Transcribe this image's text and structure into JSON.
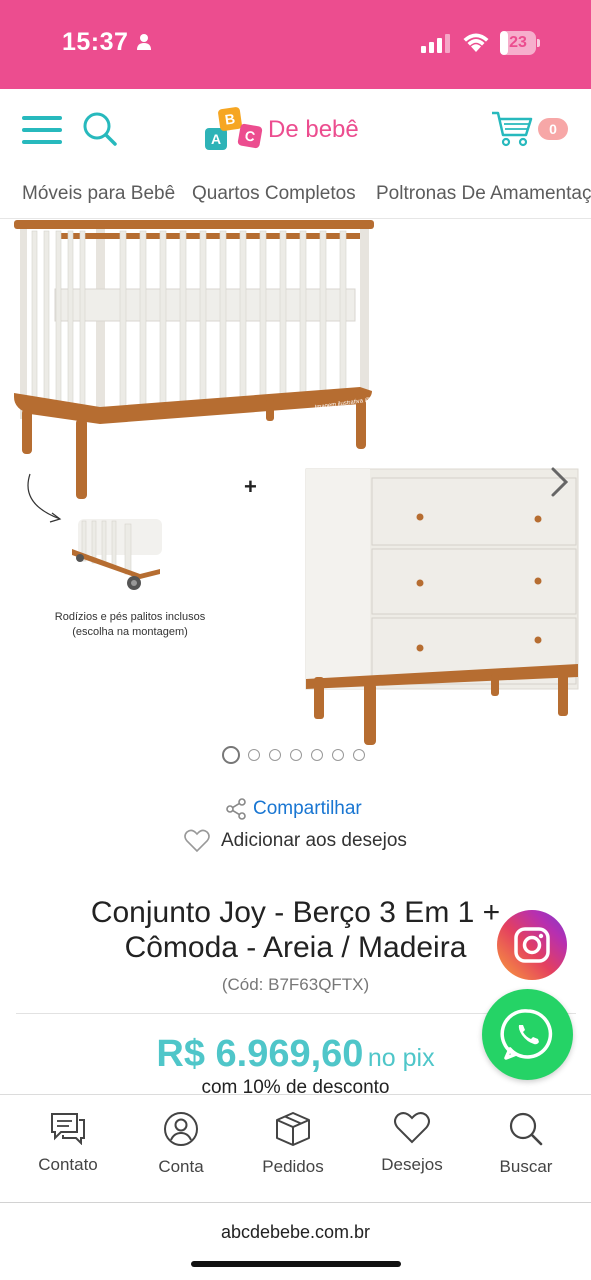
{
  "status_bar": {
    "time": "15:37",
    "battery_level": "23",
    "battery_fraction": 0.23,
    "background_color": "#ec4d8f"
  },
  "header": {
    "logo_letters": [
      "A",
      "B",
      "C"
    ],
    "logo_text": "De bebê",
    "cart_count": "0",
    "accent_color": "#27b9bd"
  },
  "category_nav": [
    "Móveis para Bebê",
    "Quartos Completos",
    "Poltronas De Amamentação"
  ],
  "gallery": {
    "watermark": "Imagem ilustrativa @abcdebebe",
    "plus_sign": "+",
    "caption_line1": "Rodízios e pés palitos inclusos",
    "caption_line2": "(escolha na montagem)",
    "dots_count": 7,
    "active_dot": 0
  },
  "actions": {
    "share": "Compartilhar",
    "wishlist": "Adicionar aos desejos"
  },
  "product": {
    "title_line1": "Conjunto Joy - Berço 3 Em 1 +",
    "title_line2": "Cômoda - Areia / Madeira",
    "code": "(Cód: B7F63QFTX)",
    "price": "R$ 6.969,60",
    "price_suffix": "no pix",
    "discount_text": "com 10% de desconto",
    "price_color": "#4fc6c9"
  },
  "bottom_nav": [
    {
      "label": "Contato",
      "icon": "chat-icon"
    },
    {
      "label": "Conta",
      "icon": "user-icon"
    },
    {
      "label": "Pedidos",
      "icon": "box-icon"
    },
    {
      "label": "Desejos",
      "icon": "heart-icon"
    },
    {
      "label": "Buscar",
      "icon": "search-icon"
    }
  ],
  "browser": {
    "url": "abcdebebe.com.br"
  }
}
